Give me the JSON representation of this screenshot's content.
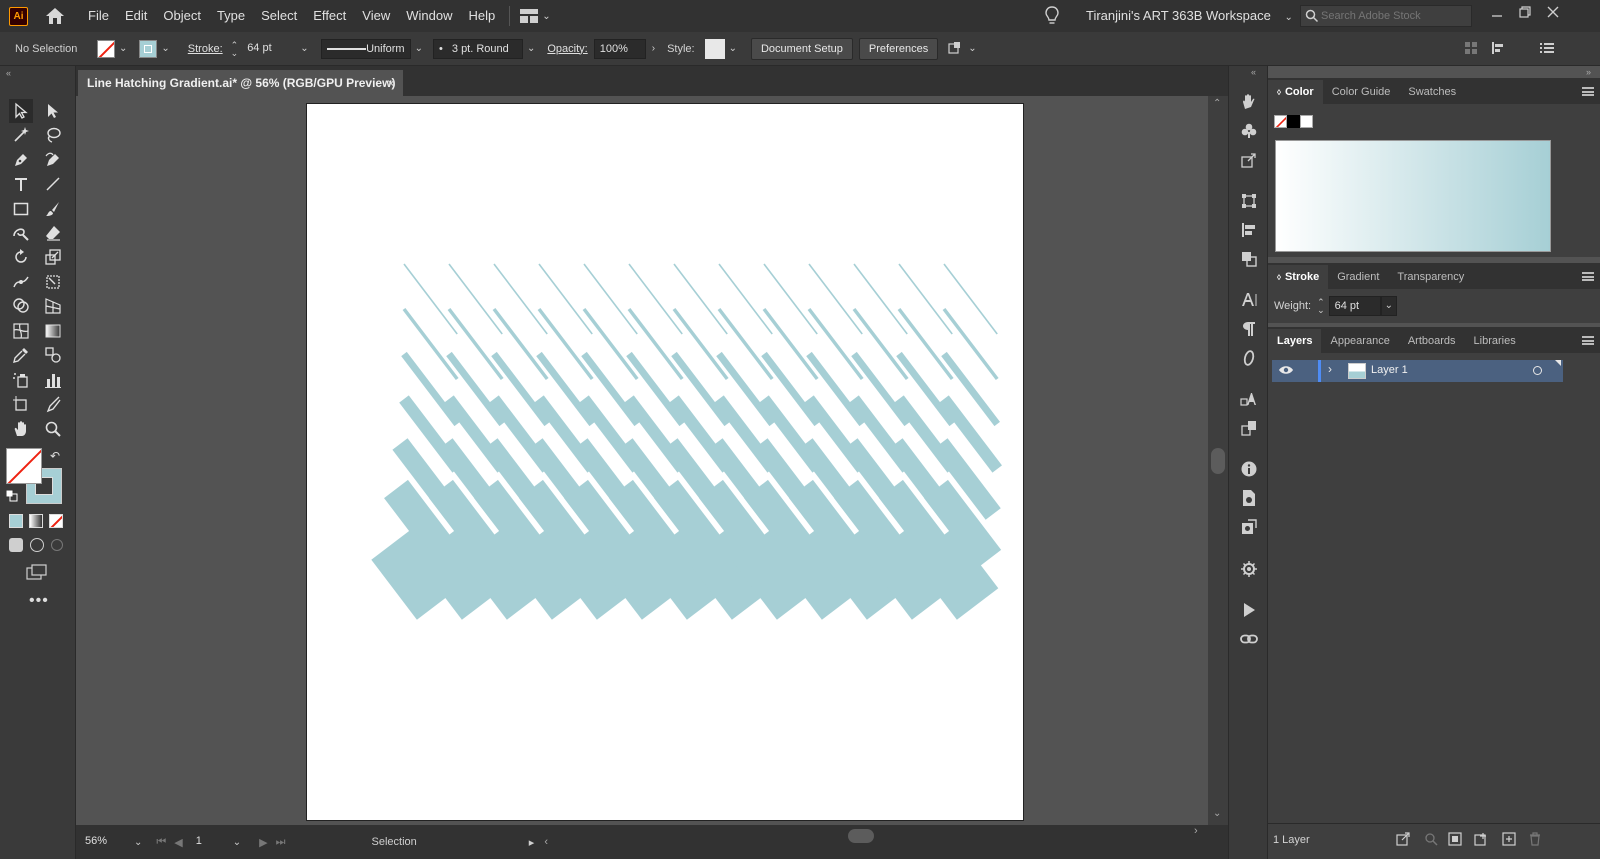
{
  "app": {
    "logo": "Ai",
    "workspace": "Tiranjini's ART 363B Workspace",
    "search_placeholder": "Search Adobe Stock"
  },
  "menu": [
    "File",
    "Edit",
    "Object",
    "Type",
    "Select",
    "Effect",
    "View",
    "Window",
    "Help"
  ],
  "control": {
    "selection": "No Selection",
    "stroke_label": "Stroke:",
    "stroke_weight": "64 pt",
    "profile": "Uniform",
    "brush": "3 pt. Round",
    "opacity_label": "Opacity:",
    "opacity": "100%",
    "style_label": "Style:",
    "document_setup": "Document Setup",
    "preferences": "Preferences"
  },
  "document": {
    "tab_title": "Line Hatching Gradient.ai* @ 56% (RGB/GPU Preview)",
    "close": "×"
  },
  "status": {
    "zoom": "56%",
    "artboard": "1",
    "tool": "Selection"
  },
  "color_panel": {
    "tabs": [
      "Color",
      "Color Guide",
      "Swatches"
    ],
    "active": "Color"
  },
  "stroke_panel": {
    "tabs": [
      "Stroke",
      "Gradient",
      "Transparency"
    ],
    "weight_label": "Weight:",
    "weight": "64 pt"
  },
  "layers_panel": {
    "tabs": [
      "Layers",
      "Appearance",
      "Artboards",
      "Libraries"
    ],
    "layer_name": "Layer 1",
    "footer": "1 Layer"
  },
  "colors": {
    "accent": "#a6cfd5",
    "ui_dark": "#323232",
    "ui_mid": "#3a3a3a",
    "canvas_bg": "#535353",
    "layer_highlight": "#4b6180"
  }
}
